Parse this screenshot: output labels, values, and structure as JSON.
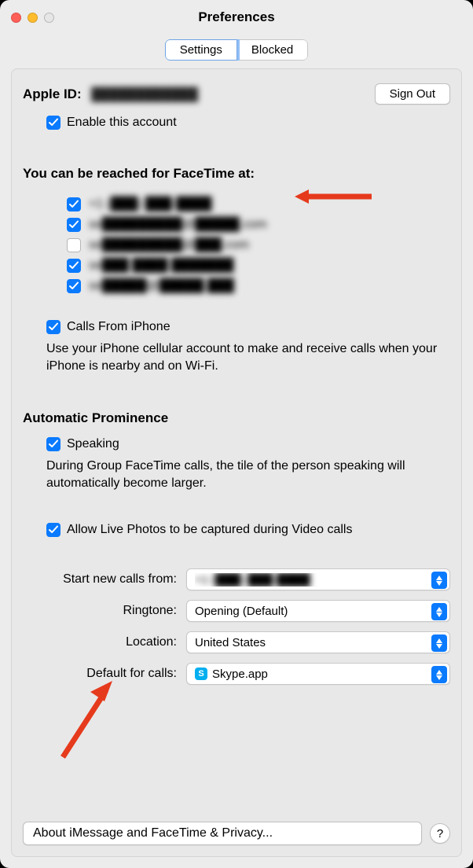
{
  "window": {
    "title": "Preferences"
  },
  "tabs": {
    "settings": "Settings",
    "blocked": "Blocked"
  },
  "apple_id": {
    "label": "Apple ID:",
    "value": "████████████",
    "sign_out": "Sign Out"
  },
  "enable_account": {
    "label": "Enable this account",
    "checked": true
  },
  "reach": {
    "heading": "You can be reached for FaceTime at:",
    "contacts": [
      {
        "checked": true,
        "text": "+1 (███) ███-████"
      },
      {
        "checked": true,
        "text": "se█████████@█████.com"
      },
      {
        "checked": false,
        "text": "se█████████@███.com"
      },
      {
        "checked": true,
        "text": "se███ ████ ███████"
      },
      {
        "checked": true,
        "text": "se█████@█████.███"
      }
    ]
  },
  "calls_iphone": {
    "label": "Calls From iPhone",
    "checked": true,
    "desc": "Use your iPhone cellular account to make and receive calls when your iPhone is nearby and on Wi-Fi."
  },
  "auto_prom": {
    "heading": "Automatic Prominence",
    "speaking_label": "Speaking",
    "speaking_checked": true,
    "desc": "During Group FaceTime calls, the tile of the person speaking will automatically become larger."
  },
  "live_photos": {
    "label": "Allow Live Photos to be captured during Video calls",
    "checked": true
  },
  "form": {
    "start_from": {
      "label": "Start new calls from:",
      "value": "+1 (███) ███-████"
    },
    "ringtone": {
      "label": "Ringtone:",
      "value": "Opening (Default)"
    },
    "location": {
      "label": "Location:",
      "value": "United States"
    },
    "default_calls": {
      "label": "Default for calls:",
      "value": "Skype.app"
    }
  },
  "footer": {
    "about": "About iMessage and FaceTime & Privacy...",
    "help": "?"
  }
}
